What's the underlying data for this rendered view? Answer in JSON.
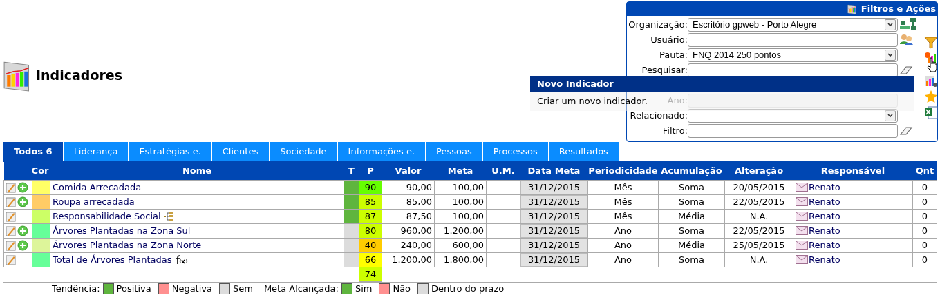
{
  "header": {
    "title": "Indicadores"
  },
  "filters": {
    "title": "Filtros e Ações",
    "fields": [
      {
        "kind": "select",
        "label": "Organização:",
        "value": "Escritório gpweb - Porto Alegre",
        "disabled": false,
        "action": {
          "kind": "org"
        }
      },
      {
        "kind": "text",
        "label": "Usuário:",
        "disabled": false,
        "action": {
          "kind": "users"
        }
      },
      {
        "kind": "select",
        "label": "Pauta:",
        "value": "FNQ 2014 250 pontos",
        "disabled": false
      },
      {
        "kind": "text",
        "label": "Pesquisar:",
        "disabled": false,
        "action": {
          "kind": "eraser"
        }
      },
      {
        "kind": "covered"
      },
      {
        "kind": "select",
        "label": "Ano:",
        "disabled": true
      },
      {
        "kind": "select",
        "label": "Relacionado:",
        "disabled": false
      },
      {
        "kind": "text",
        "label": "Filtro:",
        "disabled": false,
        "action": {
          "kind": "eraser"
        }
      }
    ]
  },
  "tooltip": {
    "title": "Novo Indicador",
    "text": "Criar um novo indicador."
  },
  "tabs": [
    {
      "label": "Todos 6",
      "selected": true
    },
    {
      "label": "Liderança",
      "selected": false
    },
    {
      "label": "Estratégias e.",
      "selected": false
    },
    {
      "label": "Clientes",
      "selected": false
    },
    {
      "label": "Sociedade",
      "selected": false
    },
    {
      "label": "Informações e.",
      "selected": false
    },
    {
      "label": "Pessoas",
      "selected": false
    },
    {
      "label": "Processos",
      "selected": false
    },
    {
      "label": "Resultados",
      "selected": false
    }
  ],
  "table": {
    "columns": [
      "Cor",
      "Nome",
      "T",
      "P",
      "Valor",
      "Meta",
      "U.M.",
      "Data Meta",
      "Periodicidade",
      "Acumulação",
      "Alteração",
      "Responsável",
      "Qnt"
    ],
    "rows": [
      {
        "add": true,
        "color": "#ffff66",
        "name": "Comida Arrecadada",
        "trend": {
          "color": "#5fb53e"
        },
        "p": {
          "text": "90",
          "color": "#66ff00"
        },
        "valor": "90,00",
        "meta": "100,00",
        "data_meta": "31/12/2015",
        "periodicidade": "Mês",
        "acumulacao": "Soma",
        "alteracao": "20/05/2015",
        "responsavel": "Renato",
        "qnt": "0"
      },
      {
        "add": true,
        "color": "#ffcc66",
        "name": "Roupa arrecadada",
        "trend": {
          "color": "#5fb53e"
        },
        "p": {
          "text": "85",
          "color": "#ccff00"
        },
        "valor": "85,00",
        "meta": "100,00",
        "data_meta": "31/12/2015",
        "periodicidade": "Mês",
        "acumulacao": "Soma",
        "alteracao": "22/05/2015",
        "responsavel": "Renato",
        "qnt": "0"
      },
      {
        "add": false,
        "color": "#ccff66",
        "name": "Responsabilidade Social",
        "name_icon": {
          "kind": "tree"
        },
        "trend": {
          "color": "#5fb53e"
        },
        "p": {
          "text": "87",
          "color": "#ccff00"
        },
        "valor": "87,50",
        "meta": "100,00",
        "data_meta": "31/12/2015",
        "periodicidade": "Mês",
        "acumulacao": "Média",
        "alteracao": "N.A.",
        "responsavel": "Renato",
        "qnt": "0"
      },
      {
        "add": true,
        "color": "#66ff99",
        "name": "Árvores Plantadas na Zona Sul",
        "trend": {
          "color": "#dcdcdc"
        },
        "p": {
          "text": "80",
          "color": "#ccff00"
        },
        "valor": "960,00",
        "meta": "1.200,00",
        "data_meta": "31/12/2015",
        "periodicidade": "Ano",
        "acumulacao": "Soma",
        "alteracao": "22/05/2015",
        "responsavel": "Renato",
        "qnt": "0"
      },
      {
        "add": true,
        "color": "#ddf59a",
        "name": "Árvores Plantadas na Zona Norte",
        "trend": {
          "color": "#dcdcdc"
        },
        "p": {
          "text": "40",
          "color": "#ffcc00"
        },
        "valor": "240,00",
        "meta": "600,00",
        "data_meta": "31/12/2015",
        "periodicidade": "Ano",
        "acumulacao": "Média",
        "alteracao": "25/05/2015",
        "responsavel": "Renato",
        "qnt": "0"
      },
      {
        "add": false,
        "color": "#66ff99",
        "name": "Total de Árvores Plantadas",
        "name_icon": {
          "kind": "formula"
        },
        "trend": {
          "color": "#dcdcdc"
        },
        "p": {
          "text": "66",
          "color": "#ffff00"
        },
        "valor": "1.200,00",
        "meta": "1.800,00",
        "data_meta": "31/12/2015",
        "periodicidade": "Ano",
        "acumulacao": "Soma",
        "alteracao": "N.A.",
        "responsavel": "Renato",
        "qnt": "0"
      }
    ],
    "total": {
      "p": {
        "text": "74",
        "color": "#ccff00"
      }
    }
  },
  "legend": [
    {
      "label": "Tendência:",
      "items": [
        {
          "label": "Positiva",
          "color": "#5fb53e"
        },
        {
          "label": "Negativa",
          "color": "#ff9090"
        },
        {
          "label": "Sem",
          "color": "#dcdcdc"
        }
      ]
    },
    {
      "label": "Meta Alcançada:",
      "items": [
        {
          "label": "Sim",
          "color": "#5fb53e"
        },
        {
          "label": "Não",
          "color": "#ff9090"
        },
        {
          "label": "Dentro do prazo",
          "color": "#dcdcdc"
        }
      ]
    }
  ]
}
